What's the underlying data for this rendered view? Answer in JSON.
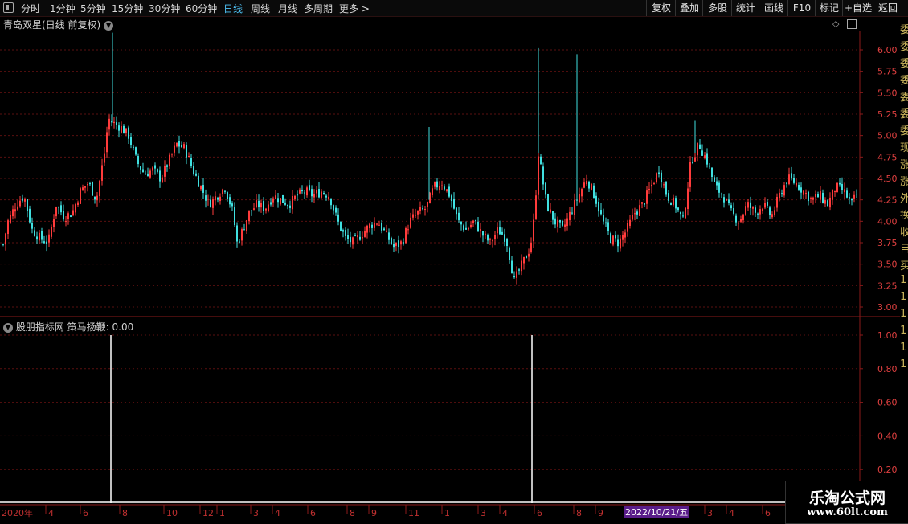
{
  "toolbar": {
    "periods": [
      {
        "label": "分时",
        "active": false
      },
      {
        "label": "1分钟",
        "active": false
      },
      {
        "label": "5分钟",
        "active": false
      },
      {
        "label": "15分钟",
        "active": false
      },
      {
        "label": "30分钟",
        "active": false
      },
      {
        "label": "60分钟",
        "active": false
      },
      {
        "label": "日线",
        "active": true
      },
      {
        "label": "周线",
        "active": false
      },
      {
        "label": "月线",
        "active": false
      },
      {
        "label": "多周期",
        "active": false
      }
    ],
    "more_label": "更多 >",
    "right_buttons": [
      "复权",
      "叠加",
      "多股",
      "统计",
      "画线",
      "F10",
      "标记",
      "+自选",
      "返回"
    ]
  },
  "main_chart": {
    "title": "青岛双星(日线 前复权)",
    "price_axis_labels": [
      "6.00",
      "5.75",
      "5.50",
      "5.25",
      "5.00",
      "4.75",
      "4.50",
      "4.25",
      "4.00",
      "3.75",
      "3.50",
      "3.25",
      "3.00"
    ]
  },
  "indicator_panel": {
    "title": "股朋指标网 策马扬鞭: 0.00",
    "axis_labels": [
      "1.00",
      "0.80",
      "0.60",
      "0.40",
      "0.20"
    ]
  },
  "time_axis": {
    "start_label": "2020年",
    "labels": [
      "4",
      "6",
      "8",
      "10",
      "12",
      "1",
      "3",
      "4",
      "6",
      "8",
      "9",
      "11",
      "1",
      "3",
      "4",
      "6",
      "8",
      "9",
      "3",
      "4",
      "6"
    ]
  },
  "date_badge": "2022/10/21/五",
  "right_strip_chars": [
    "委",
    "委",
    "委",
    "委",
    "委",
    "委",
    "委",
    "现",
    "涨",
    "涨",
    "外",
    "换",
    "收",
    "目",
    "买",
    "1",
    "1",
    "1",
    "1",
    "1",
    "1"
  ],
  "logo": {
    "line1": "乐淘公式网",
    "line2": "www.60lt.com"
  },
  "colors": {
    "up": "#ff3b3b",
    "down": "#40e0e0",
    "axis": "#8b1a1a",
    "grid": "#5a0f0f",
    "indicator_line": "#ffffff"
  },
  "chart_data": [
    {
      "type": "line",
      "title": "青岛双星(日线 前复权)",
      "ylim": [
        3.0,
        6.0
      ],
      "x": [
        0,
        10,
        20,
        30,
        40,
        50,
        60,
        70,
        80,
        90,
        100,
        110,
        120,
        130,
        135,
        140,
        150,
        160,
        170,
        180,
        190,
        200,
        210,
        220,
        230,
        240,
        250,
        260,
        270,
        280,
        290,
        295,
        300,
        310,
        320,
        330,
        340,
        350,
        360,
        370,
        380,
        390,
        400,
        410,
        420,
        430,
        440,
        450,
        460,
        470,
        480,
        490,
        500,
        510,
        520,
        530,
        540,
        550,
        560,
        570,
        580,
        590,
        600,
        610,
        620,
        630,
        640,
        650,
        660,
        665,
        670,
        680,
        690,
        700,
        710,
        720,
        730,
        740,
        750,
        760,
        770,
        780,
        790,
        800,
        810,
        820,
        830,
        840,
        850,
        860,
        870,
        880,
        890,
        900,
        910,
        920,
        930,
        940,
        950,
        960,
        970,
        980,
        990,
        1000,
        1010,
        1020,
        1030,
        1040,
        1050,
        1060,
        1068
      ],
      "y": [
        3.55,
        4.0,
        4.2,
        4.3,
        3.9,
        3.8,
        3.75,
        4.2,
        4.05,
        4.1,
        4.35,
        4.45,
        4.25,
        4.8,
        5.2,
        5.15,
        5.1,
        5.0,
        4.7,
        4.55,
        4.6,
        4.5,
        4.7,
        4.9,
        4.85,
        4.6,
        4.4,
        4.2,
        4.3,
        4.4,
        4.1,
        3.75,
        3.85,
        4.1,
        4.2,
        4.15,
        4.3,
        4.25,
        4.2,
        4.3,
        4.35,
        4.3,
        4.35,
        4.3,
        4.0,
        3.8,
        3.75,
        3.85,
        3.95,
        4.0,
        3.85,
        3.7,
        3.75,
        4.0,
        4.1,
        4.15,
        4.4,
        4.45,
        4.3,
        4.0,
        3.9,
        4.0,
        3.85,
        3.75,
        3.9,
        3.8,
        3.3,
        3.5,
        3.7,
        4.05,
        4.8,
        4.2,
        4.0,
        3.9,
        4.1,
        4.3,
        4.5,
        4.3,
        4.0,
        3.8,
        3.75,
        3.9,
        4.1,
        4.2,
        4.4,
        4.6,
        4.3,
        4.2,
        4.0,
        4.7,
        4.9,
        4.7,
        4.4,
        4.3,
        4.1,
        4.0,
        4.2,
        4.1,
        4.2,
        4.05,
        4.3,
        4.5,
        4.45,
        4.35,
        4.25,
        4.3,
        4.2,
        4.4,
        4.35,
        4.2,
        4.35
      ]
    },
    {
      "type": "line",
      "title": "股朋指标网 策马扬鞭: 0.00",
      "ylim": [
        0,
        1.0
      ],
      "series": [
        {
          "name": "策马扬鞭",
          "spikes": [
            {
              "x": 138,
              "value": 1.0
            },
            {
              "x": 662,
              "value": 1.0
            }
          ],
          "baseline": 0.0
        }
      ]
    }
  ]
}
